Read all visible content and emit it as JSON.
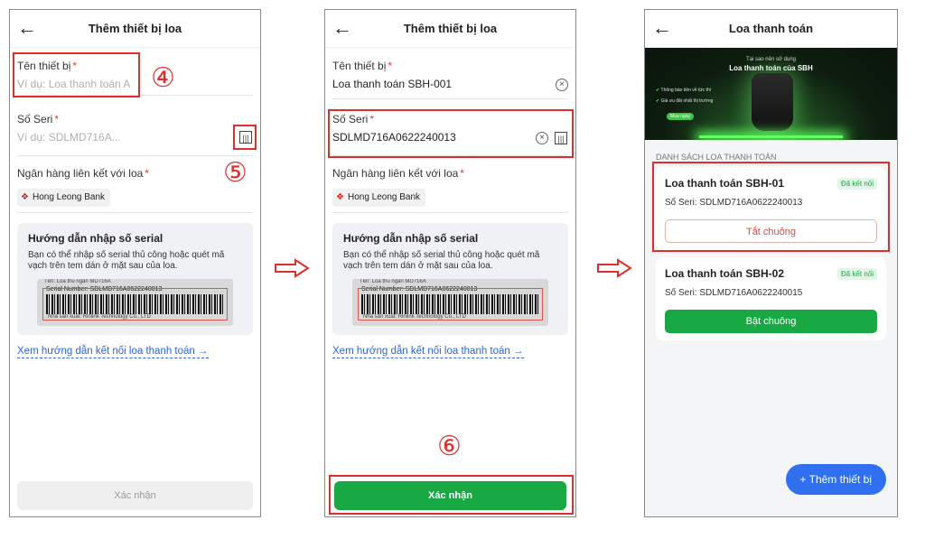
{
  "phone1": {
    "title": "Thêm thiết bị loa",
    "device_name_label": "Tên thiết bị",
    "device_name_placeholder": "Ví dụ: Loa thanh toán A",
    "serial_label": "Số Seri",
    "serial_placeholder": "Ví dụ: SDLMD716A...",
    "bank_label": "Ngân hàng liên kết với loa",
    "bank_value": "Hong Leong Bank",
    "guide_title": "Hướng dẫn nhập số serial",
    "guide_text": "Bạn có thể nhập số serial thủ công hoặc quét mã vạch trên tem dán ở mặt sau của loa.",
    "label_top": "Tên: Loa thu ngân MD716A",
    "label_serial": "Serial Number:   SDLMD716A0622240013",
    "label_bottom": "Nhà sản xuất: Rinlink Technology Co., LTD",
    "link": "Xem hướng dẫn kết nối loa thanh toán →",
    "confirm": "Xác nhận",
    "step_a": "④",
    "step_b": "⑤"
  },
  "phone2": {
    "title": "Thêm thiết bị loa",
    "device_name_label": "Tên thiết bị",
    "device_name_value": "Loa thanh toán SBH-001",
    "serial_label": "Số Seri",
    "serial_value": "SDLMD716A0622240013",
    "bank_label": "Ngân hàng liên kết với loa",
    "bank_value": "Hong Leong Bank",
    "guide_title": "Hướng dẫn nhập số serial",
    "guide_text": "Bạn có thể nhập số serial thủ công hoặc quét mã vạch trên tem dán ở mặt sau của loa.",
    "label_top": "Tên: Loa thu ngân MD716A",
    "label_serial": "Serial Number:   SDLMD716A0622240013",
    "label_bottom": "Nhà sản xuất: Rinlink Technology Co., LTD",
    "link": "Xem hướng dẫn kết nối loa thanh toán →",
    "confirm": "Xác nhận",
    "step": "⑥"
  },
  "phone3": {
    "title": "Loa thanh toán",
    "banner_small": "Tại sao nên sử dụng",
    "banner_title": "Loa thanh toán của SBH",
    "banner_feat1": "Thông báo tiền về tức thì",
    "banner_feat2": "Giá ưu đãi nhất thị trường",
    "banner_chip": "Mua ngay",
    "section": "DANH SÁCH LOA THANH TOÁN",
    "devices": [
      {
        "name": "Loa thanh toán SBH-01",
        "status": "Đã kết nối",
        "serial": "Số Seri: SDLMD716A0622240013",
        "action": "Tắt chuông"
      },
      {
        "name": "Loa thanh toán SBH-02",
        "status": "Đã kết nối",
        "serial": "Số Seri: SDLMD716A0622240015",
        "action": "Bật chuông"
      }
    ],
    "add_button": "+ Thêm thiết bị"
  },
  "icons": {
    "back": "back-arrow-icon",
    "clear": "clear-circle-icon",
    "scan": "barcode-scan-icon",
    "bank": "bank-logo-icon",
    "next": "right-outline-arrow-icon"
  },
  "colors": {
    "highlight": "#e02d2d",
    "primary_green": "#18a844",
    "link_blue": "#2f63d9",
    "fab_blue": "#2f6ff0"
  }
}
